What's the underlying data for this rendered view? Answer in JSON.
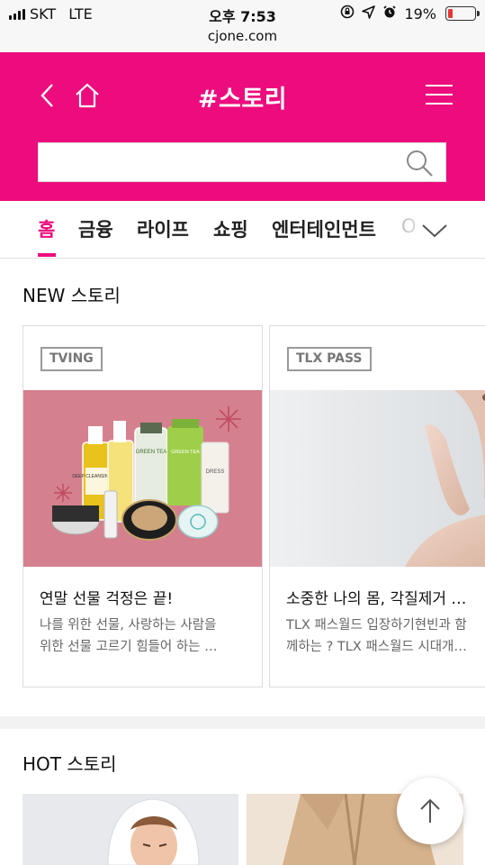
{
  "status_bar": {
    "carrier": "SKT",
    "network": "LTE",
    "time": "오후 7:53",
    "battery_percent": "19%",
    "battery_level": 0.19,
    "icons": [
      "rotation-lock-icon",
      "location-icon",
      "alarm-icon"
    ]
  },
  "browser": {
    "url": "cjone.com"
  },
  "header": {
    "title": "#스토리",
    "bg_color": "#ec0c7d",
    "search": {
      "value": "",
      "placeholder": ""
    }
  },
  "tabs": [
    {
      "label": "홈",
      "active": true
    },
    {
      "label": "금융",
      "active": false
    },
    {
      "label": "라이프",
      "active": false
    },
    {
      "label": "쇼핑",
      "active": false
    },
    {
      "label": "엔터테인먼트",
      "active": false
    },
    {
      "label": "O",
      "active": false
    }
  ],
  "new_story": {
    "title": "NEW 스토리",
    "cards": [
      {
        "badge": "TVING",
        "title": "연말 선물 걱정은 끝!",
        "desc_line1": "나를 위한 선물, 사랑하는 사람을",
        "desc_line2": "위한 선물 고르기 힘들어 하는 …",
        "product_labels": [
          "DEEP CLEANSING OIL",
          "GREEN TEA",
          "GREEN TEA",
          "DRESS"
        ]
      },
      {
        "badge": "TLX PASS",
        "title": "소중한 나의 몸, 각질제거 …",
        "desc_line1": "TLX 패스월드 입장하기현빈과 함",
        "desc_line2": "께하는 ? TLX 패스월드 시대개…"
      }
    ]
  },
  "hot_story": {
    "title": "HOT 스토리"
  },
  "colors": {
    "accent": "#ec0c7d",
    "card_pink": "#d5808e"
  }
}
